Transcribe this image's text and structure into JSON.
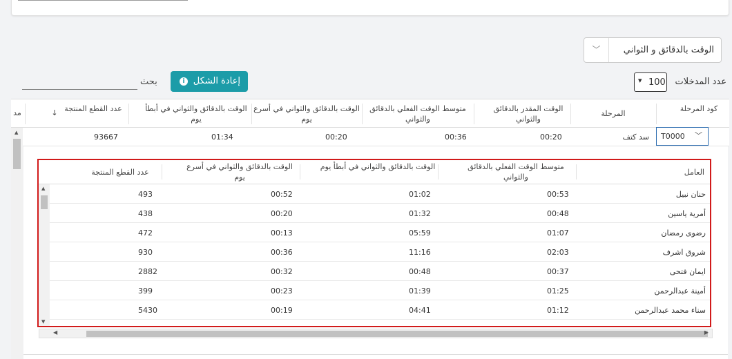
{
  "time_mode": {
    "selected": "الوقت بالدقائق و الثواني"
  },
  "controls": {
    "entries_label": "عدد المدخلات",
    "entries_value": "100",
    "reset_label": "إعادة الشكل",
    "search_label": "بحث",
    "search_value": ""
  },
  "main_table": {
    "columns": [
      "كود المرحلة",
      "المرحلة",
      "الوقت المقدر بالدقائق والثواني",
      "متوسط الوقت الفعلي بالدقائق والثواني",
      "الوقت بالدقائق والثواني في أسرع يوم",
      "الوقت بالدقائق والثواني في أبطأ يوم",
      "عدد القطع المنتجة",
      "مد"
    ],
    "sort_icon": "↓",
    "row": {
      "code": "T0000",
      "stage": "سد كتف",
      "estimated": "00:20",
      "avg_actual": "00:36",
      "fastest": "00:20",
      "slowest": "01:34",
      "pieces": "93667"
    }
  },
  "sub_table": {
    "columns": [
      "العامل",
      "متوسط الوقت الفعلي بالدقائق والثواني",
      "الوقت بالدقائق والثواني في أبطأ يوم",
      "الوقت بالدقائق والثواني في أسرع يوم",
      "عدد القطع المنتجة"
    ],
    "rows": [
      {
        "worker": "حنان نبيل",
        "avg": "00:53",
        "slowest": "01:02",
        "fastest": "00:52",
        "pieces": "493"
      },
      {
        "worker": "أمرية ياسين",
        "avg": "00:48",
        "slowest": "01:32",
        "fastest": "00:20",
        "pieces": "438"
      },
      {
        "worker": "رضوى رمضان",
        "avg": "01:07",
        "slowest": "05:59",
        "fastest": "00:13",
        "pieces": "472"
      },
      {
        "worker": "شروق اشرف",
        "avg": "02:03",
        "slowest": "11:16",
        "fastest": "00:36",
        "pieces": "930"
      },
      {
        "worker": "ايمان فتحى",
        "avg": "00:37",
        "slowest": "00:48",
        "fastest": "00:32",
        "pieces": "2882"
      },
      {
        "worker": "أمينة عبدالرحمن",
        "avg": "01:25",
        "slowest": "01:39",
        "fastest": "00:23",
        "pieces": "399"
      },
      {
        "worker": "سناء محمد عبدالرحمن",
        "avg": "01:12",
        "slowest": "04:41",
        "fastest": "00:19",
        "pieces": "5430"
      }
    ]
  }
}
